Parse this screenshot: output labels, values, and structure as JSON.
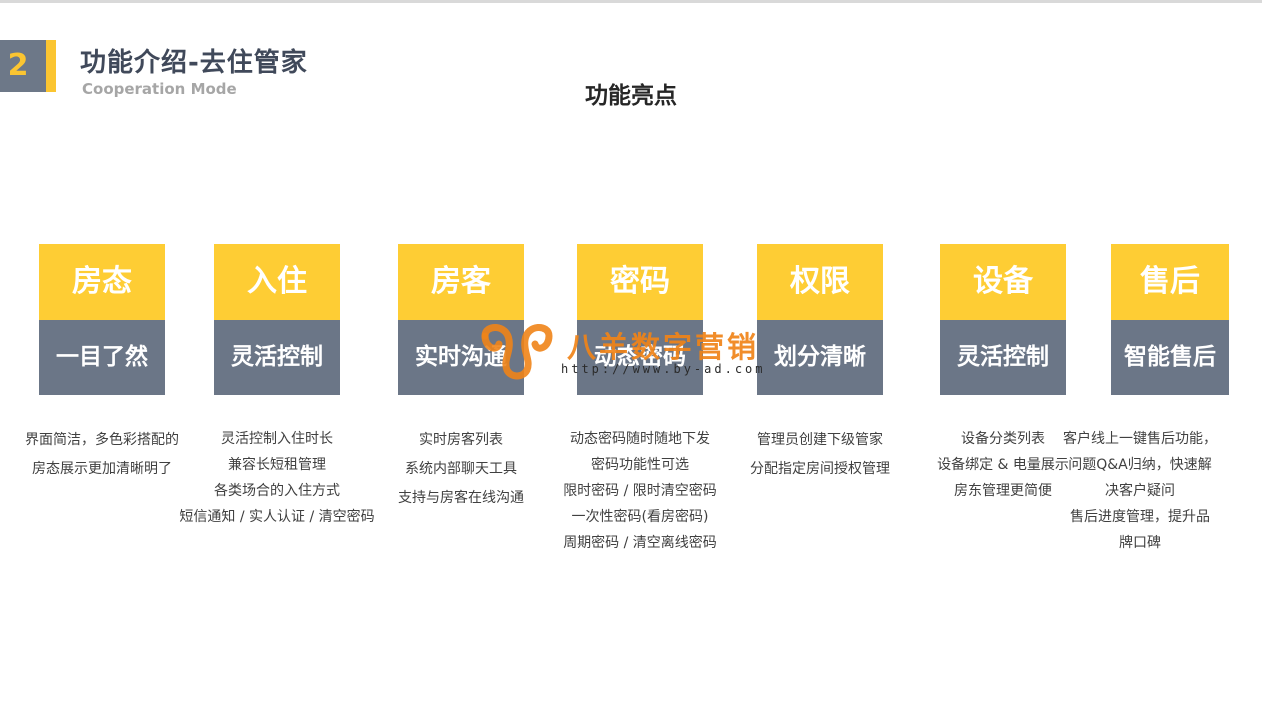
{
  "header": {
    "section_number": "2",
    "title": "功能介绍-去住管家",
    "subtitle": "Cooperation Mode",
    "heading": "功能亮点"
  },
  "features": [
    {
      "title": "房态",
      "subtitle": "一目了然",
      "lines": [
        "界面简洁，多色彩搭配的",
        "房态展示更加清晰明了"
      ]
    },
    {
      "title": "入住",
      "subtitle": "灵活控制",
      "lines": [
        "灵活控制入住时长",
        "兼容长短租管理",
        "各类场合的入住方式",
        "短信通知 / 实人认证 / 清空密码"
      ]
    },
    {
      "title": "房客",
      "subtitle": "实时沟通",
      "lines": [
        "实时房客列表",
        "系统内部聊天工具",
        "支持与房客在线沟通"
      ]
    },
    {
      "title": "密码",
      "subtitle": "动态密码",
      "lines": [
        "动态密码随时随地下发",
        "密码功能性可选",
        "限时密码 / 限时清空密码",
        "一次性密码(看房密码)",
        "周期密码 / 清空离线密码"
      ]
    },
    {
      "title": "权限",
      "subtitle": "划分清晰",
      "lines": [
        "管理员创建下级管家",
        "分配指定房间授权管理"
      ]
    },
    {
      "title": "设备",
      "subtitle": "灵活控制",
      "lines": [
        "设备分类列表",
        "设备绑定 & 电量展示",
        "房东管理更简便"
      ]
    },
    {
      "title": "售后",
      "subtitle": "智能售后",
      "lines": [
        "客户线上一键售后功能，",
        "问题Q&A归纳，快速解",
        "决客户疑问",
        "售后进度管理，提升品",
        "牌口碑"
      ]
    }
  ],
  "watermark": {
    "text": "八羊数字营销",
    "url": "http://www.by-ad.com",
    "color": "#f08418"
  },
  "colors": {
    "accent_yellow": "#fecd34",
    "slate": "#6b7687",
    "title": "#40495a"
  }
}
